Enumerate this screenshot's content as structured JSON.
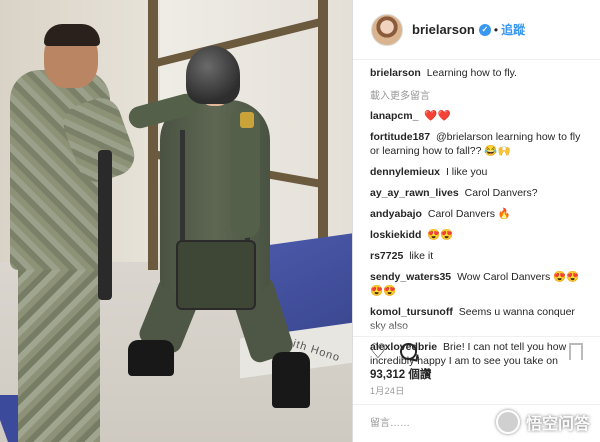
{
  "post": {
    "username": "brielarson",
    "follow_label": "追蹤",
    "caption": "Learning how to fly.",
    "load_more": "載入更多留言",
    "likes": "93,312 個讚",
    "date": "1月24日",
    "comment_placeholder": "留言……",
    "photo_text": "ith Hono"
  },
  "comments": [
    {
      "user": "lanapcm_",
      "text": "❤️❤️"
    },
    {
      "user": "fortitude187",
      "text": "@brielarson learning how to fly or learning how to fall?? 😂🙌"
    },
    {
      "user": "dennylemieux",
      "text": "I like you"
    },
    {
      "user": "ay_ay_rawn_lives",
      "text": "Carol Danvers?"
    },
    {
      "user": "andyabajo",
      "text": "Carol Danvers 🔥"
    },
    {
      "user": "loskiekidd",
      "text": "😍😍"
    },
    {
      "user": "rs7725",
      "text": "like it"
    },
    {
      "user": "sendy_waters35",
      "text": "Wow Carol Danvers 😍😍😍😍"
    },
    {
      "user": "komol_tursunoff",
      "text": "Seems u wanna conquer sky also"
    },
    {
      "user": "alexlovedbrie",
      "text": "Brie! I can not tell you how incredibly happy I am to see you take on"
    }
  ],
  "watermark": "悟空问答",
  "icons": {
    "like": "heart-icon",
    "comment": "comment-bubble-icon",
    "save": "bookmark-icon",
    "verified": "verified-badge-icon"
  },
  "colors": {
    "link": "#3897f0",
    "text": "#262626",
    "muted": "#999999"
  }
}
